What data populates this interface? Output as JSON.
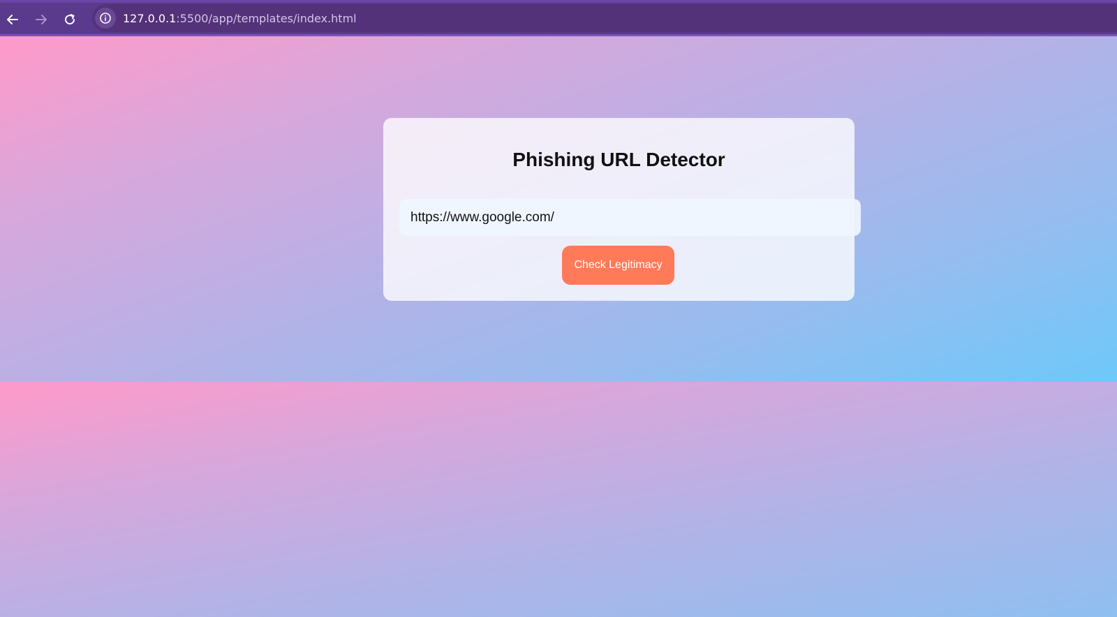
{
  "browser": {
    "url_host": "127.0.0.1",
    "url_rest": ":5500/app/templates/index.html",
    "back_icon": "arrow-left-icon",
    "forward_icon": "arrow-right-icon",
    "reload_icon": "reload-icon",
    "site_info_icon": "info-icon"
  },
  "page": {
    "title": "Phishing URL Detector",
    "url_input_value": "https://www.google.com/",
    "check_button_label": "Check Legitimacy"
  },
  "colors": {
    "browser_bar": "#5a3a8c",
    "button": "#ff7a59",
    "gradient_start": "#ff9ac9",
    "gradient_end": "#6ec8fa"
  }
}
